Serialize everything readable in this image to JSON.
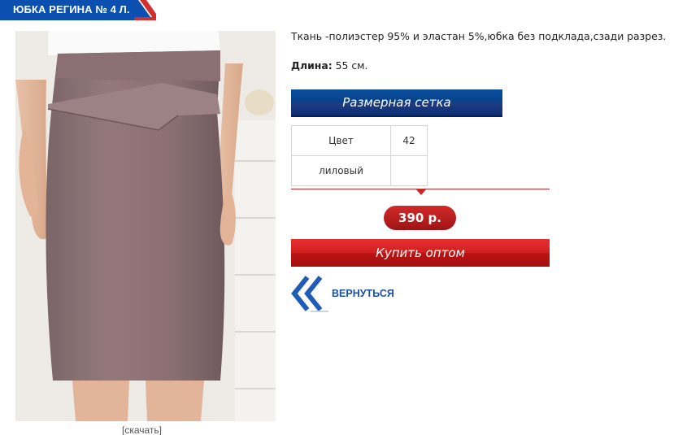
{
  "product": {
    "title": "ЮБКА РЕГИНА № 4 Л.",
    "description": "Ткань -полиэстер 95% и эластан 5%,юбка без подклада,сзади разрез.",
    "length_label": "Длина:",
    "length_value": "55 см.",
    "download_link": "[скачать]"
  },
  "size_chart": {
    "button_label": "Размерная сетка",
    "header": [
      "Цвет",
      "42"
    ],
    "rows": [
      [
        "лиловый",
        ""
      ]
    ]
  },
  "price": "390 р.",
  "buy_button": "Купить оптом",
  "back_link": "ВЕРНУТЬСЯ",
  "colors": {
    "title_blue": "#0b4fb0",
    "accent_red": "#c62828",
    "size_bar_blue": "#07418a",
    "link_blue": "#1c4fa3"
  },
  "icons": {
    "back": "double-chevron-left-icon"
  }
}
